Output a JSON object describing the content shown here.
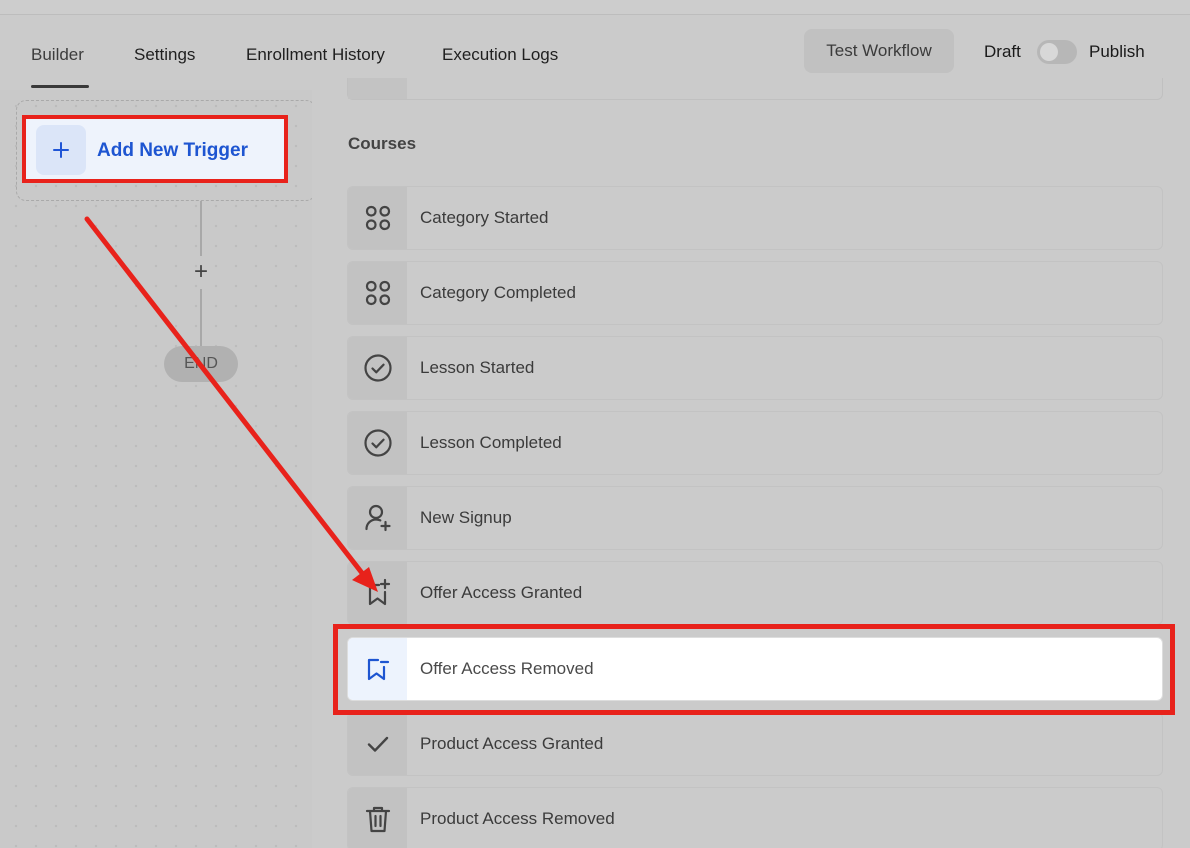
{
  "tabs": [
    {
      "label": "Builder",
      "active": true
    },
    {
      "label": "Settings",
      "active": false
    },
    {
      "label": "Enrollment History",
      "active": false
    },
    {
      "label": "Execution Logs",
      "active": false
    }
  ],
  "header": {
    "test_button": "Test Workflow",
    "draft_label": "Draft",
    "publish_label": "Publish",
    "toggle_on": false
  },
  "canvas": {
    "trigger_label": "Add New Trigger",
    "add_step": "+",
    "end_label": "END"
  },
  "panel": {
    "section_title": "Courses",
    "items": [
      {
        "label": "Category Started",
        "icon": "grid-icon"
      },
      {
        "label": "Category Completed",
        "icon": "grid-icon"
      },
      {
        "label": "Lesson Started",
        "icon": "check-circle-icon"
      },
      {
        "label": "Lesson Completed",
        "icon": "check-circle-icon"
      },
      {
        "label": "New Signup",
        "icon": "user-plus-icon"
      },
      {
        "label": "Offer Access Granted",
        "icon": "bookmark-plus-icon"
      },
      {
        "label": "Offer Access Removed",
        "icon": "bookmark-minus-icon",
        "selected": true
      },
      {
        "label": "Product Access Granted",
        "icon": "check-icon"
      },
      {
        "label": "Product Access Removed",
        "icon": "trash-icon"
      }
    ]
  },
  "colors": {
    "accent": "#1e55d1",
    "annotation": "#e8221b",
    "overlay_bg": "#cbcbcb"
  }
}
